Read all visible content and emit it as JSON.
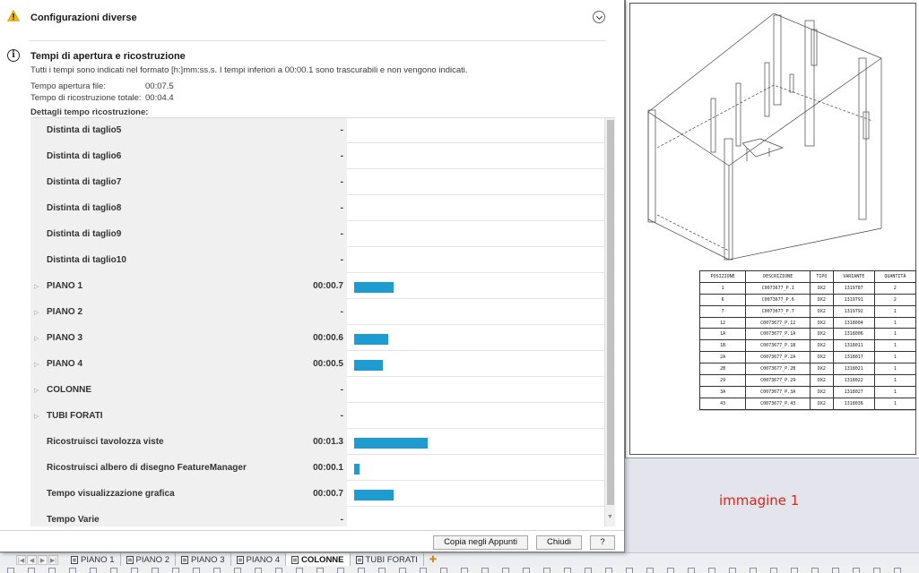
{
  "dialog": {
    "section_title": "Configurazioni diverse",
    "times_title": "Tempi di apertura e ricostruzione",
    "times_note": "Tutti i tempi sono indicati nel formato [h:]mm:ss.s. I tempi inferiori a 00:00.1 sono trascurabili e non vengono indicati.",
    "open_time_label": "Tempo apertura file:",
    "open_time_value": "00:07.5",
    "rebuild_total_label": "Tempo di ricostruzione totale:",
    "rebuild_total_value": "00:04.4",
    "details_label": "Dettagli tempo ricostruzione:",
    "rows": [
      {
        "name": "Distinta di taglio5",
        "time": "-",
        "seconds": 0,
        "expandable": false
      },
      {
        "name": "Distinta di taglio6",
        "time": "-",
        "seconds": 0,
        "expandable": false
      },
      {
        "name": "Distinta di taglio7",
        "time": "-",
        "seconds": 0,
        "expandable": false
      },
      {
        "name": "Distinta di taglio8",
        "time": "-",
        "seconds": 0,
        "expandable": false
      },
      {
        "name": "Distinta di taglio9",
        "time": "-",
        "seconds": 0,
        "expandable": false
      },
      {
        "name": "Distinta di taglio10",
        "time": "-",
        "seconds": 0,
        "expandable": false
      },
      {
        "name": "PIANO 1",
        "time": "00:00.7",
        "seconds": 0.7,
        "expandable": true
      },
      {
        "name": "PIANO 2",
        "time": "-",
        "seconds": 0,
        "expandable": true
      },
      {
        "name": "PIANO 3",
        "time": "00:00.6",
        "seconds": 0.6,
        "expandable": true
      },
      {
        "name": "PIANO 4",
        "time": "00:00.5",
        "seconds": 0.5,
        "expandable": true
      },
      {
        "name": "COLONNE",
        "time": "-",
        "seconds": 0,
        "expandable": true
      },
      {
        "name": "TUBI FORATI",
        "time": "-",
        "seconds": 0,
        "expandable": true
      },
      {
        "name": "Ricostruisci tavolozza viste",
        "time": "00:01.3",
        "seconds": 1.3,
        "expandable": false
      },
      {
        "name": "Ricostruisci albero di disegno FeatureManager",
        "time": "00:00.1",
        "seconds": 0.1,
        "expandable": false
      },
      {
        "name": "Tempo visualizzazione grafica",
        "time": "00:00.7",
        "seconds": 0.7,
        "expandable": false
      },
      {
        "name": "Tempo Varie",
        "time": "-",
        "seconds": 0,
        "expandable": false
      }
    ],
    "buttons": {
      "copy": "Copia negli Appunti",
      "close": "Chiudi",
      "help": "?"
    }
  },
  "colors": {
    "bar": "#1e9bd0",
    "warning": "#f2b705",
    "caption": "#e0261c"
  },
  "drawing": {
    "caption": "immagine 1",
    "bom_headers": [
      "POSIZIONE",
      "DESCRIZIONE",
      "TIPO",
      "VARIANTE",
      "QUANTITÀ"
    ],
    "bom_rows": [
      [
        "1",
        "C0073677_P.1",
        "DX2",
        "1319787",
        "2"
      ],
      [
        "6",
        "C0073677_P.6",
        "DX2",
        "1319791",
        "2"
      ],
      [
        "7",
        "C0073677_P.7",
        "DX2",
        "1319792",
        "1"
      ],
      [
        "12",
        "C0073677_P.12",
        "DX2",
        "1318004",
        "1"
      ],
      [
        "1A",
        "C0073677_P.1A",
        "DX2",
        "1318006",
        "1"
      ],
      [
        "1B",
        "C0073677_P.1B",
        "DX2",
        "1318011",
        "1"
      ],
      [
        "2A",
        "C0073677_P.2A",
        "DX2",
        "1318017",
        "1"
      ],
      [
        "2B",
        "C0073677_P.2B",
        "DX2",
        "1318021",
        "1"
      ],
      [
        "29",
        "C0073677_P.29",
        "DX2",
        "1318022",
        "1"
      ],
      [
        "3A",
        "C0073677_P.3A",
        "DX2",
        "1318027",
        "1"
      ],
      [
        "43",
        "C0073677_P.43",
        "DX2",
        "1318036",
        "1"
      ]
    ]
  },
  "sheet_tabs": [
    {
      "label": "PIANO 1",
      "active": false
    },
    {
      "label": "PIANO 2",
      "active": false
    },
    {
      "label": "PIANO 3",
      "active": false
    },
    {
      "label": "PIANO 4",
      "active": false
    },
    {
      "label": "COLONNE",
      "active": true
    },
    {
      "label": "TUBI FORATI",
      "active": false
    }
  ],
  "icons": {
    "warning": "warning-icon",
    "info": "info-icon",
    "collapse": "chevron-down-icon",
    "expander": "triangle-right-icon",
    "sheet": "sheet-document-icon",
    "add_sheet": "add-sheet-icon"
  }
}
